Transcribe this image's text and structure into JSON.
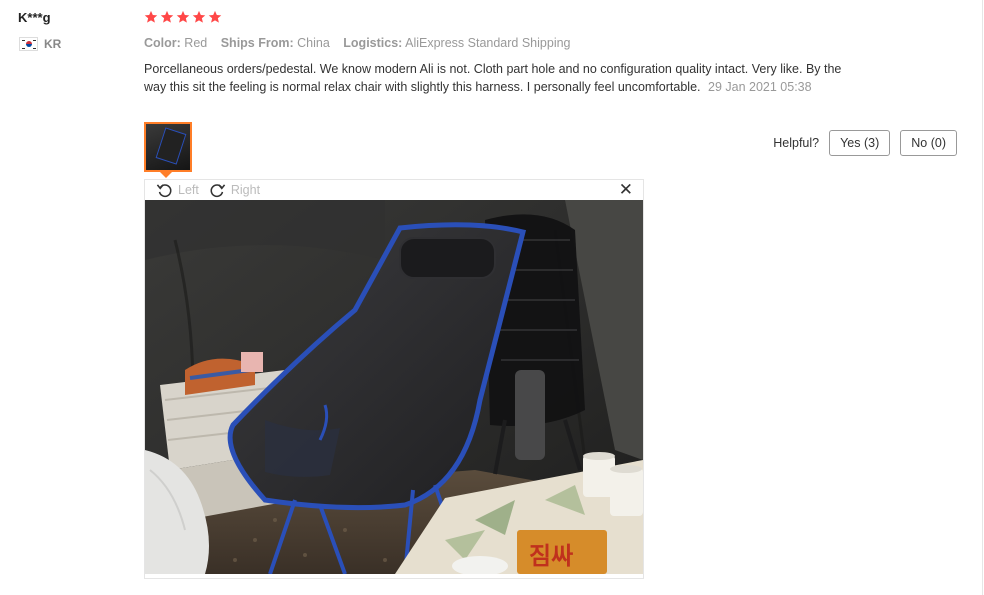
{
  "buyer": {
    "name": "K***g",
    "country_code": "KR"
  },
  "rating": {
    "stars": 5,
    "color": "#ff4747"
  },
  "meta": [
    {
      "key": "Color:",
      "value": "Red"
    },
    {
      "key": "Ships From:",
      "value": "China"
    },
    {
      "key": "Logistics:",
      "value": "AliExpress Standard Shipping"
    }
  ],
  "review": {
    "text": "Porcellaneous orders/pedestal. We know modern Ali is not. Cloth part hole and no configuration quality intact. Very like. By the way this sit the feeling is normal relax chair with slightly this harness. I personally feel uncomfortable.",
    "date": "29 Jan 2021 05:38"
  },
  "helpful": {
    "label": "Helpful?",
    "yes": "Yes (3)",
    "no": "No (0)"
  },
  "viewer": {
    "rotate_left": "Left",
    "rotate_right": "Right",
    "close": "✕"
  },
  "photo": {
    "snack_text": "짐싸"
  },
  "colors": {
    "accent": "#ff7e28",
    "chair_frame": "#2a4fb8"
  }
}
